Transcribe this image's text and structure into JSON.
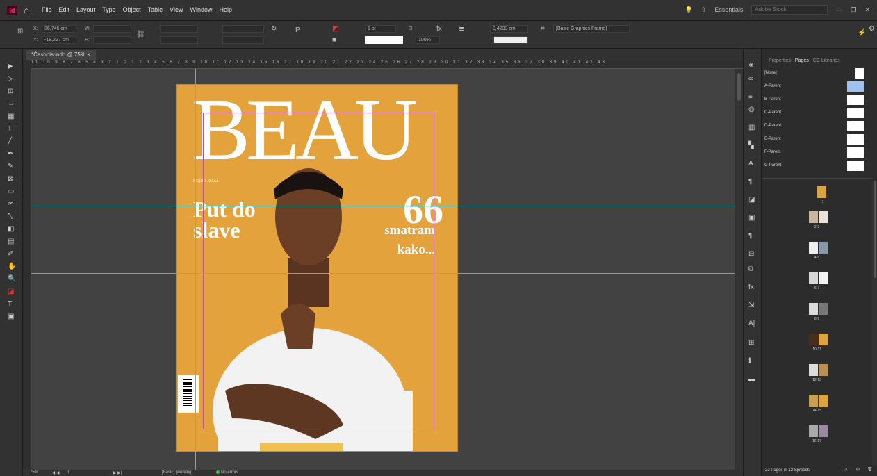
{
  "menubar": {
    "logo_text": "Id",
    "items": [
      "File",
      "Edit",
      "Layout",
      "Type",
      "Object",
      "Table",
      "View",
      "Window",
      "Help"
    ],
    "workspace": "Essentials",
    "search_placeholder": "Adobe Stock"
  },
  "control": {
    "x_label": "X:",
    "y_label": "Y:",
    "w_label": "W:",
    "h_label": "H:",
    "x_value": "36,746 cm",
    "y_value": "-18,227 cm",
    "stroke_weight": "1 pt",
    "opacity": "100%",
    "gap": "0,4233 cm",
    "object_style": "[Basic Graphics Frame]"
  },
  "document": {
    "tab_label": "*Časopis.indd @ 75%",
    "close": "×"
  },
  "ruler": {
    "marks": "11 10 9 8 7 6 5 4 3 2 1 0 1 2 3 4 5 6 7 8 9 10 11 12 13 14 15 16 17 18 19 20 21 22 23 24 25 26 27 28 29 30 31 32 33 34 35 36 37 38 39 40 41 42 43"
  },
  "cover": {
    "masthead": "BEAU",
    "date": "Rujan 2022.",
    "headline": "Put do slave",
    "quote_mark": "66",
    "quote_line1": "smatram",
    "quote_line2": "kako..."
  },
  "status": {
    "zoom": "75%",
    "page": "1",
    "style": "[Basic] (working)",
    "preflight": "No errors"
  },
  "panel": {
    "tabs": [
      "Properties",
      "Pages",
      "CC Libraries"
    ],
    "parents": [
      "[None]",
      "A-Parent",
      "B-Parent",
      "C-Parent",
      "D-Parent",
      "E-Parent",
      "F-Parent",
      "G-Parent"
    ],
    "spreads": [
      "1",
      "2-3",
      "4-5",
      "6-7",
      "8-9",
      "10-11",
      "12-13",
      "14-15",
      "16-17"
    ],
    "footer": "22 Pages in 12 Spreads"
  },
  "colors": {
    "cover_bg": "#e3a23c",
    "guide": "#3fc4c6",
    "margin": "#c14da0",
    "selected_parent": "#9fc1ee"
  }
}
